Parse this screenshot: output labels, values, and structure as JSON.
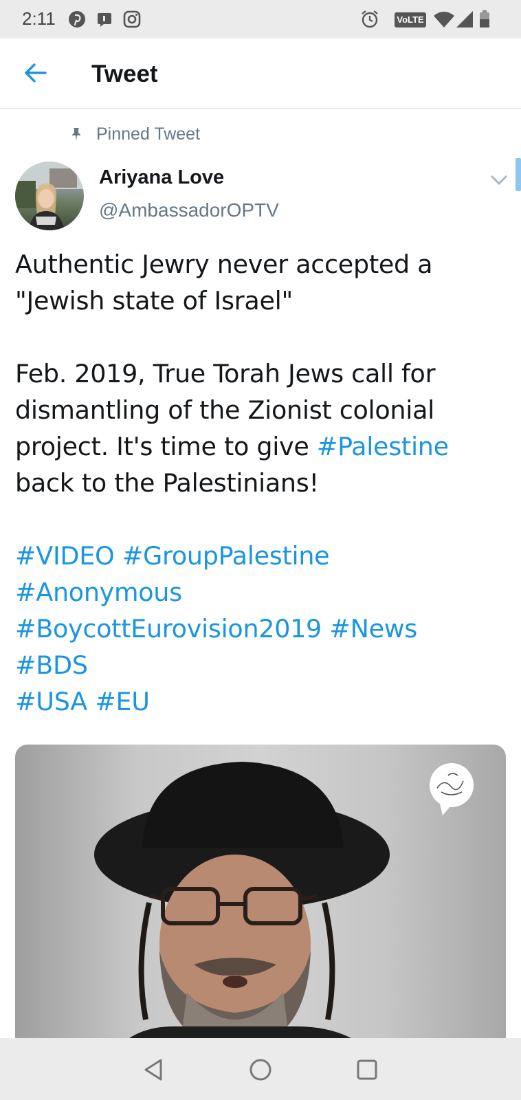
{
  "status_bar": {
    "time": "2:11",
    "left_icons": [
      "pinterest-icon",
      "notification-icon",
      "instagram-icon"
    ],
    "right_icons": [
      "alarm-icon",
      "volte-icon",
      "wifi-icon",
      "signal-icon",
      "battery-icon"
    ],
    "volte_label": "VoLTE"
  },
  "app_bar": {
    "title": "Tweet",
    "back_icon": "arrow-left-icon",
    "accent_color": "#1b95e0"
  },
  "tweet": {
    "pinned_label": "Pinned Tweet",
    "author": {
      "name": "Ariyana Love",
      "handle": "@AmbassadorOPTV"
    },
    "lines": {
      "l1": "Authentic Jewry never accepted a",
      "l2": "\"Jewish state of Israel\"",
      "l3": "Feb. 2019,  True Torah Jews call for",
      "l4": "dismantling of the Zionist colonial",
      "l5_text": "project. It's time to give ",
      "l5_tag": "#Palestine",
      "l6": "back to the Palestinians!"
    },
    "hashtags": {
      "video": "#VIDEO",
      "group_palestine": "#GroupPalestine",
      "anonymous": "#Anonymous",
      "boycott": "#BoycottEurovision2019",
      "news": "#News",
      "bds": "#BDS",
      "usa": "#USA",
      "eu": "#EU"
    },
    "media": {
      "type": "video thumbnail"
    }
  },
  "nav_bar": {
    "buttons": [
      "back-triangle-icon",
      "home-circle-icon",
      "recents-square-icon"
    ]
  }
}
